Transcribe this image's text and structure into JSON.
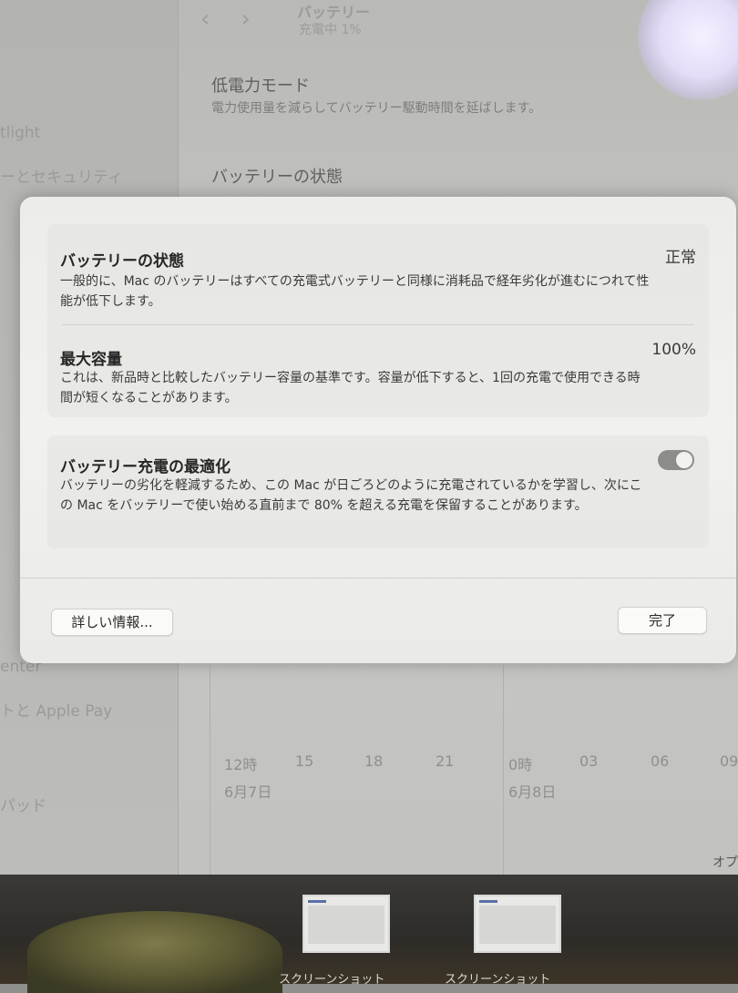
{
  "background": {
    "header": {
      "title": "バッテリー",
      "subtitle": "充電中 1%"
    },
    "rows": [
      {
        "title": "低電力モード",
        "desc": "電力使用量を減らしてバッテリー駆動時間を延ばします。"
      },
      {
        "title": "バッテリーの状態"
      }
    ],
    "sidebar": {
      "items": [
        "tlight",
        "ーとセキュリティ",
        "enter",
        "トと Apple Pay",
        "パッド"
      ]
    },
    "chart": {
      "ticks": [
        "12時",
        "15",
        "18",
        "21",
        "0時",
        "03",
        "06",
        "09"
      ],
      "dates": [
        "6月7日",
        "6月8日"
      ]
    },
    "option_label": "オプ"
  },
  "dialog": {
    "battery_health": {
      "title": "バッテリーの状態",
      "value": "正常",
      "desc": "一般的に、Mac のバッテリーはすべての充電式バッテリーと同様に消耗品で経年劣化が進むにつれて性能が低下します。"
    },
    "max_capacity": {
      "title": "最大容量",
      "value": "100%",
      "desc": "これは、新品時と比較したバッテリー容量の基準です。容量が低下すると、1回の充電で使用できる時間が短くなることがあります。"
    },
    "optimized_charging": {
      "title": "バッテリー充電の最適化",
      "enabled": true,
      "desc": "バッテリーの劣化を軽減するため、この Mac が日ごろどのように充電されているかを学習し、次にこの Mac をバッテリーで使い始める直前まで 80% を超える充電を保留することがあります。"
    },
    "buttons": {
      "more_info": "詳しい情報...",
      "done": "完了"
    }
  },
  "dock": {
    "thumbnails": [
      "スクリーンショット",
      "スクリーンショット"
    ]
  }
}
